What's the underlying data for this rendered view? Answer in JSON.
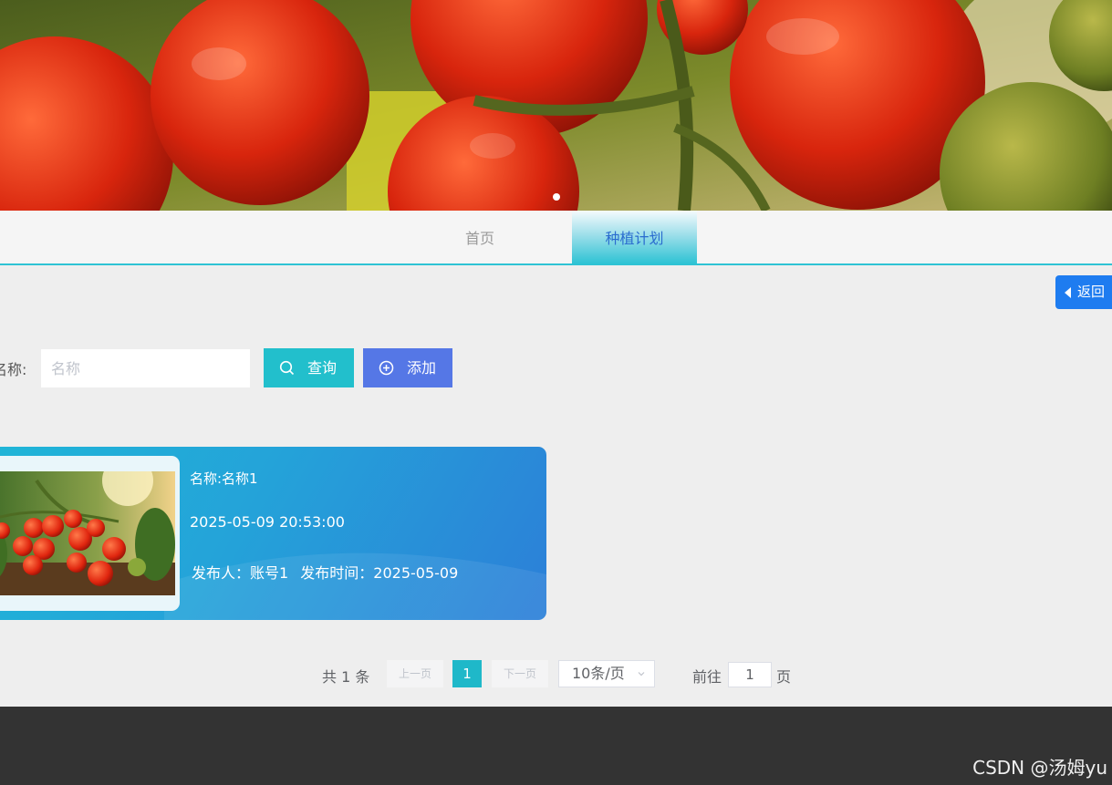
{
  "nav": {
    "tabs": [
      {
        "label": "首页",
        "active": false
      },
      {
        "label": "种植计划",
        "active": true
      }
    ]
  },
  "back_button": {
    "label": "返回"
  },
  "search": {
    "label": "名称:",
    "placeholder": "名称",
    "query_label": "查询",
    "add_label": "添加"
  },
  "card": {
    "name": "名称:名称1",
    "time": "2025-05-09 20:53:00",
    "publisher": "发布人：账号1",
    "publish_time": "发布时间：2025-05-09"
  },
  "pagination": {
    "total": "共 1 条",
    "prev": "上一页",
    "current": "1",
    "next": "下一页",
    "page_size": "10条/页",
    "goto": "前往",
    "goto_value": "1",
    "page_unit": "页"
  },
  "watermark": "CSDN @汤姆yu",
  "colors": {
    "accent": "#2ec3d4",
    "query_button": "#22bfcc",
    "add_button": "#5577e6",
    "back_button": "#1e7cf0",
    "footer": "#333333"
  },
  "icons": {
    "back": "caret-left-icon",
    "query": "search-icon",
    "add": "plus-circle-icon",
    "page_size": "chevron-down-icon"
  }
}
